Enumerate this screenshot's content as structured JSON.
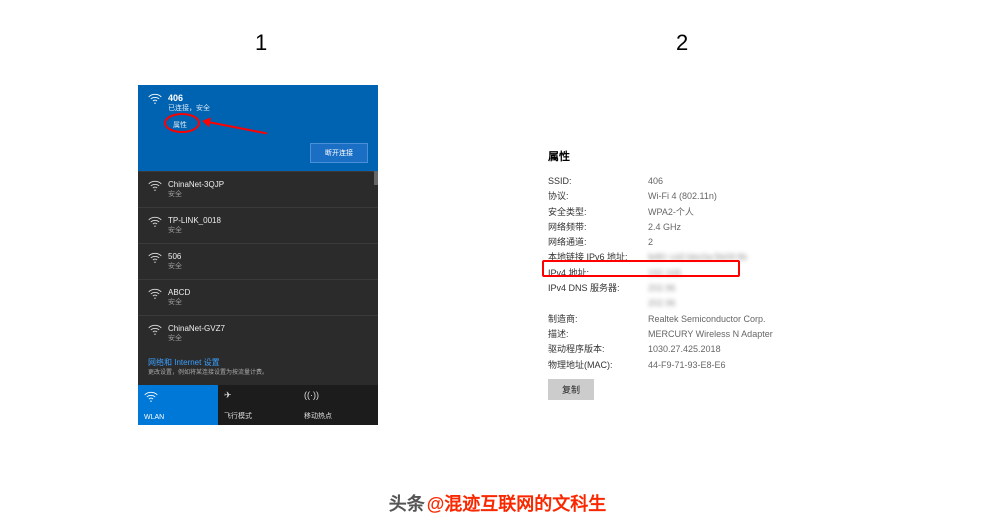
{
  "labels": {
    "one": "1",
    "two": "2"
  },
  "flyout": {
    "connected": {
      "ssid": "406",
      "status": "已连接，安全",
      "properties_label": "属性",
      "disconnect_label": "断开连接"
    },
    "networks": [
      {
        "name": "ChinaNet-3QJP",
        "security": "安全"
      },
      {
        "name": "TP-LINK_0018",
        "security": "安全"
      },
      {
        "name": "506",
        "security": "安全"
      },
      {
        "name": "ABCD",
        "security": "安全"
      },
      {
        "name": "ChinaNet-GVZ7",
        "security": "安全"
      }
    ],
    "settings_link": "网络和 Internet 设置",
    "settings_sub": "更改设置，例如将某连接设置为按流量计费。",
    "tiles": [
      {
        "label": "WLAN",
        "icon": "wifi",
        "active": true
      },
      {
        "label": "飞行模式",
        "icon": "airplane",
        "active": false
      },
      {
        "label": "移动热点",
        "icon": "hotspot",
        "active": false
      }
    ]
  },
  "props": {
    "title": "属性",
    "rows": [
      {
        "k": "SSID:",
        "v": "406"
      },
      {
        "k": "协议:",
        "v": "Wi-Fi 4 (802.11n)"
      },
      {
        "k": "安全类型:",
        "v": "WPA2-个人"
      },
      {
        "k": "网络频带:",
        "v": "2.4 GHz"
      },
      {
        "k": "网络通道:",
        "v": "2"
      },
      {
        "k": "本地链接 IPv6 地址:",
        "v": "fe80::cd2:bbc0a:5b09:9b"
      },
      {
        "k": "IPv4 地址:",
        "v": "192.168."
      },
      {
        "k": "IPv4 DNS 服务器:",
        "v": "202.96\n202.96"
      },
      {
        "k": "制造商:",
        "v": "Realtek Semiconductor Corp."
      },
      {
        "k": "描述:",
        "v": "MERCURY Wireless N Adapter"
      },
      {
        "k": "驱动程序版本:",
        "v": "1030.27.425.2018"
      },
      {
        "k": "物理地址(MAC):",
        "v": "44-F9-71-93-E8-E6"
      }
    ],
    "copy_label": "复制"
  },
  "watermark": {
    "label": "头条",
    "handle": "@混迹互联网的文科生"
  }
}
